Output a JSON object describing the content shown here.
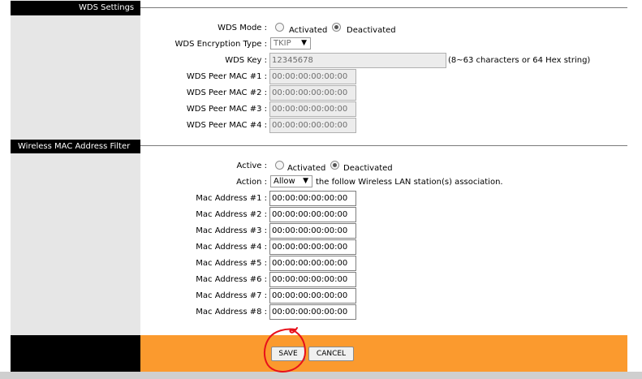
{
  "wds": {
    "title": "WDS Settings",
    "mode_label": "WDS Mode :",
    "mode_options": [
      "Activated",
      "Deactivated"
    ],
    "mode_selected": "Deactivated",
    "encryption_label": "WDS Encryption Type :",
    "encryption_value": "TKIP",
    "key_label": "WDS Key :",
    "key_value": "12345678",
    "key_hint": "(8~63 characters or 64 Hex string)",
    "peers": [
      {
        "label": "WDS Peer MAC #1 :",
        "value": "00:00:00:00:00:00"
      },
      {
        "label": "WDS Peer MAC #2 :",
        "value": "00:00:00:00:00:00"
      },
      {
        "label": "WDS Peer MAC #3 :",
        "value": "00:00:00:00:00:00"
      },
      {
        "label": "WDS Peer MAC #4 :",
        "value": "00:00:00:00:00:00"
      }
    ]
  },
  "mac_filter": {
    "title": "Wireless MAC Address Filter",
    "active_label": "Active :",
    "active_options": [
      "Activated",
      "Deactivated"
    ],
    "active_selected": "Deactivated",
    "action_label": "Action :",
    "action_value": "Allow",
    "action_suffix": "the follow Wireless LAN station(s) association.",
    "addresses": [
      {
        "label": "Mac Address #1 :",
        "value": "00:00:00:00:00:00"
      },
      {
        "label": "Mac Address #2 :",
        "value": "00:00:00:00:00:00"
      },
      {
        "label": "Mac Address #3 :",
        "value": "00:00:00:00:00:00"
      },
      {
        "label": "Mac Address #4 :",
        "value": "00:00:00:00:00:00"
      },
      {
        "label": "Mac Address #5 :",
        "value": "00:00:00:00:00:00"
      },
      {
        "label": "Mac Address #6 :",
        "value": "00:00:00:00:00:00"
      },
      {
        "label": "Mac Address #7 :",
        "value": "00:00:00:00:00:00"
      },
      {
        "label": "Mac Address #8 :",
        "value": "00:00:00:00:00:00"
      }
    ]
  },
  "footer": {
    "save_label": "SAVE",
    "cancel_label": "CANCEL"
  },
  "colors": {
    "footer_bar": "#fb9a2e",
    "sidebar": "#e6e6e6",
    "header_black": "#000000",
    "annotation_circle": "#e8101a"
  }
}
